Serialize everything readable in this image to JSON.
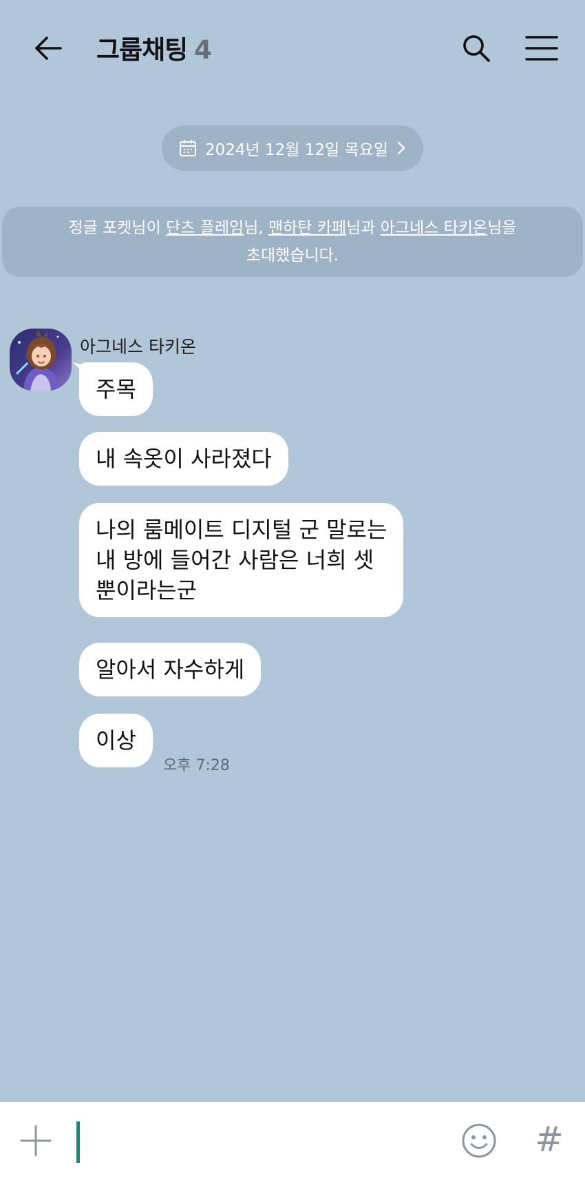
{
  "header": {
    "title": "그룹채팅",
    "member_count": "4",
    "back_icon": "arrow-left-icon",
    "search_icon": "search-icon",
    "menu_icon": "hamburger-menu-icon"
  },
  "date_divider": {
    "label": "2024년 12월 12일 목요일",
    "icon": "calendar-icon"
  },
  "system_message": {
    "prefix": "정글 포켓님이 ",
    "name1": "단츠 플레임",
    "sep1": "님, ",
    "name2": "맨하탄 카페",
    "sep2": "님과 ",
    "name3": "아그네스 타키온",
    "suffix": "님을",
    "line2": "초대했습니다."
  },
  "sender": {
    "name": "아그네스 타키온"
  },
  "messages": [
    "주목",
    "내 속옷이 사라졌다",
    "나의 룸메이트 디지털 군 말로는",
    "내 방에 들어간 사람은 너희 셋",
    "뿐이라는군",
    "알아서 자수하게",
    "이상"
  ],
  "last_message_time": "오후 7:28",
  "input_bar": {
    "placeholder": "",
    "hash_label": "#"
  },
  "colors": {
    "background": "#b1c6d9",
    "pill": "#9fb3c6",
    "bubble": "#ffffff",
    "caret": "#1a8a78"
  }
}
